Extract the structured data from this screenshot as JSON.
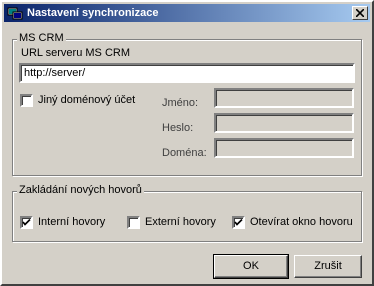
{
  "window": {
    "title": "Nastavení synchronizace"
  },
  "ms_crm": {
    "group_label": "MS CRM",
    "url_label": "URL serveru MS CRM",
    "url_value": "http://server/",
    "other_domain_label": "Jiný doménový účet",
    "other_domain_checked": false,
    "name_label": "Jméno:",
    "password_label": "Heslo:",
    "domain_label": "Doména:"
  },
  "calls": {
    "group_label": "Zakládání nových hovorů",
    "internal_label": "Interní hovory",
    "internal_checked": true,
    "external_label": "Externí hovory",
    "external_checked": false,
    "open_window_label": "Otevírat okno hovoru",
    "open_window_checked": true
  },
  "buttons": {
    "ok_label": "OK",
    "cancel_label": "Zrušit"
  },
  "icons": {
    "app": "sync-settings-icon",
    "close": "close-icon"
  }
}
